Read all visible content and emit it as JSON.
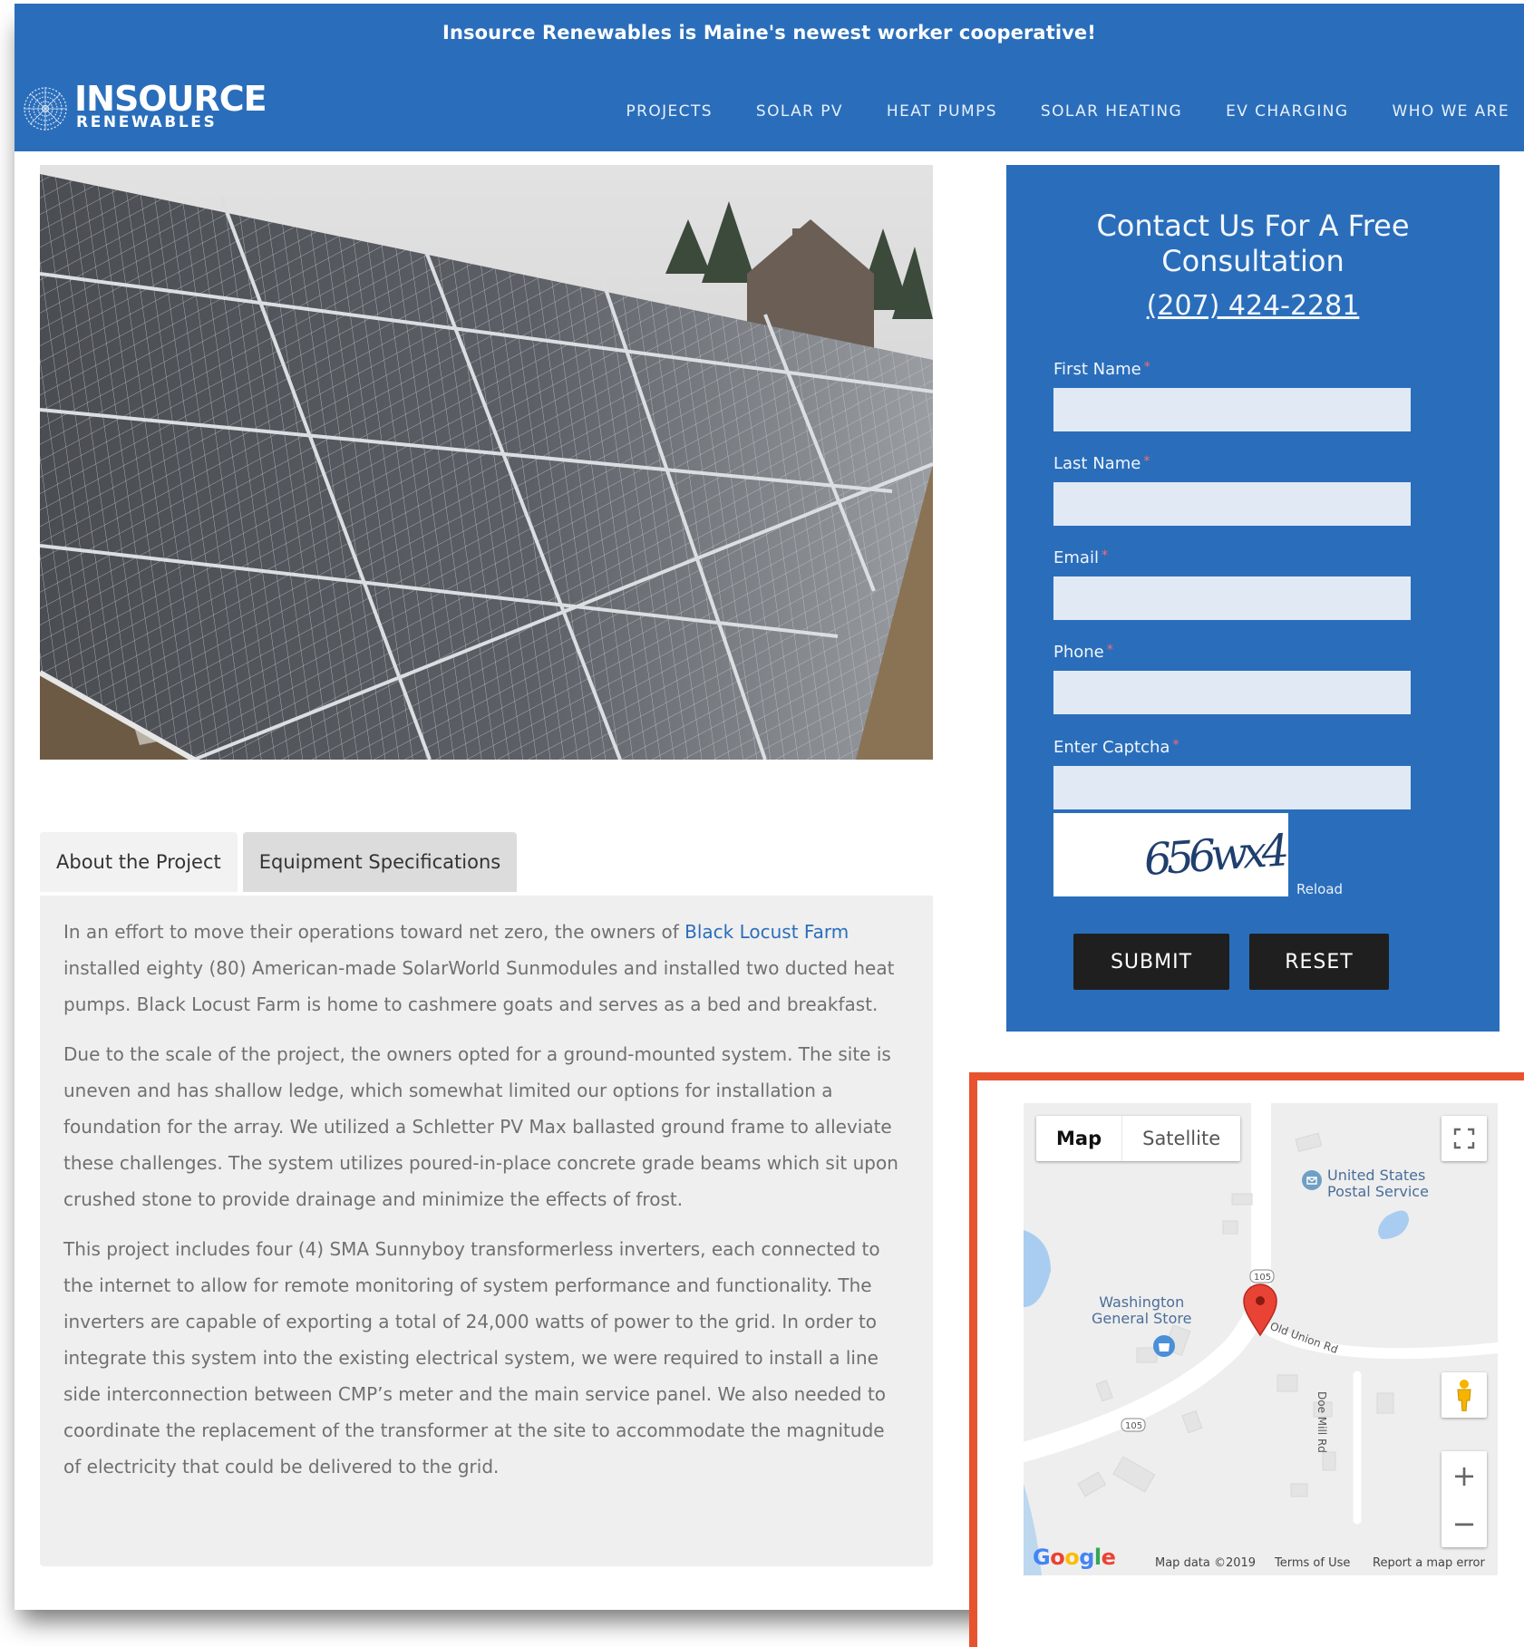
{
  "colors": {
    "brand_blue": "#2a6ebb",
    "button_dark": "#1f1f1f",
    "link_blue": "#2a6ebb",
    "highlight_orange": "#e8532f",
    "panel_gray": "#efefef"
  },
  "header": {
    "announcement": "Insource Renewables is Maine's newest worker cooperative!",
    "logo": {
      "word1": "INSOURCE",
      "word2": "RENEWABLES"
    },
    "nav": [
      "PROJECTS",
      "SOLAR PV",
      "HEAT PUMPS",
      "SOLAR HEATING",
      "EV CHARGING",
      "WHO WE ARE"
    ]
  },
  "tabs": [
    {
      "label": "About the Project",
      "active": false
    },
    {
      "label": "Equipment Specifications",
      "active": true
    }
  ],
  "content": {
    "p1_before": "In an effort to move their operations toward net zero, the owners of ",
    "p1_link": "Black Locust Farm",
    "p1_after": " installed eighty (80) American-made SolarWorld Sunmodules and installed two ducted heat pumps. Black Locust Farm is home to cashmere goats and serves as a bed and breakfast.",
    "p2": "Due to the scale of the project, the owners opted for a ground-mounted system. The site is uneven and has shallow ledge, which somewhat limited our options for installation a foundation for the array. We utilized a Schletter PV Max ballasted ground frame to alleviate these challenges. The system utilizes poured-in-place concrete grade beams which sit upon crushed stone to provide drainage and minimize the effects of frost.",
    "p3": "This project includes four (4) SMA Sunnyboy transformerless inverters, each connected to the internet to allow for remote monitoring of system performance and functionality. The inverters are capable of exporting a total of 24,000 watts of power to the grid. In order to integrate this system into the existing electrical system, we were required to install a line side interconnection between CMP’s meter and the main service panel. We also needed to coordinate the replacement of the transformer at the site to accommodate the magnitude of electricity that could be delivered to the grid."
  },
  "contact": {
    "title_line1": "Contact Us For A Free",
    "title_line2": "Consultation",
    "phone": "(207) 424-2281",
    "fields": {
      "first_name": {
        "label": "First Name",
        "value": ""
      },
      "last_name": {
        "label": "Last Name",
        "value": ""
      },
      "email": {
        "label": "Email",
        "value": ""
      },
      "phone": {
        "label": "Phone",
        "value": ""
      },
      "captcha": {
        "label": "Enter Captcha",
        "value": ""
      }
    },
    "required_mark": "*",
    "captcha_text": "656wx4",
    "reload": "Reload",
    "submit": "SUBMIT",
    "reset": "RESET"
  },
  "map": {
    "type_map": "Map",
    "type_satellite": "Satellite",
    "places": {
      "usps": [
        "United States",
        "Postal Service"
      ],
      "store": [
        "Washington",
        "General Store"
      ]
    },
    "roads": {
      "route": "105",
      "old_union": "Old Union Rd",
      "doe_mill": "Doe Mill Rd"
    },
    "zoom_in": "+",
    "zoom_out": "−",
    "google": "Google",
    "footer": {
      "data": "Map data ©2019",
      "terms": "Terms of Use",
      "report": "Report a map error"
    }
  }
}
